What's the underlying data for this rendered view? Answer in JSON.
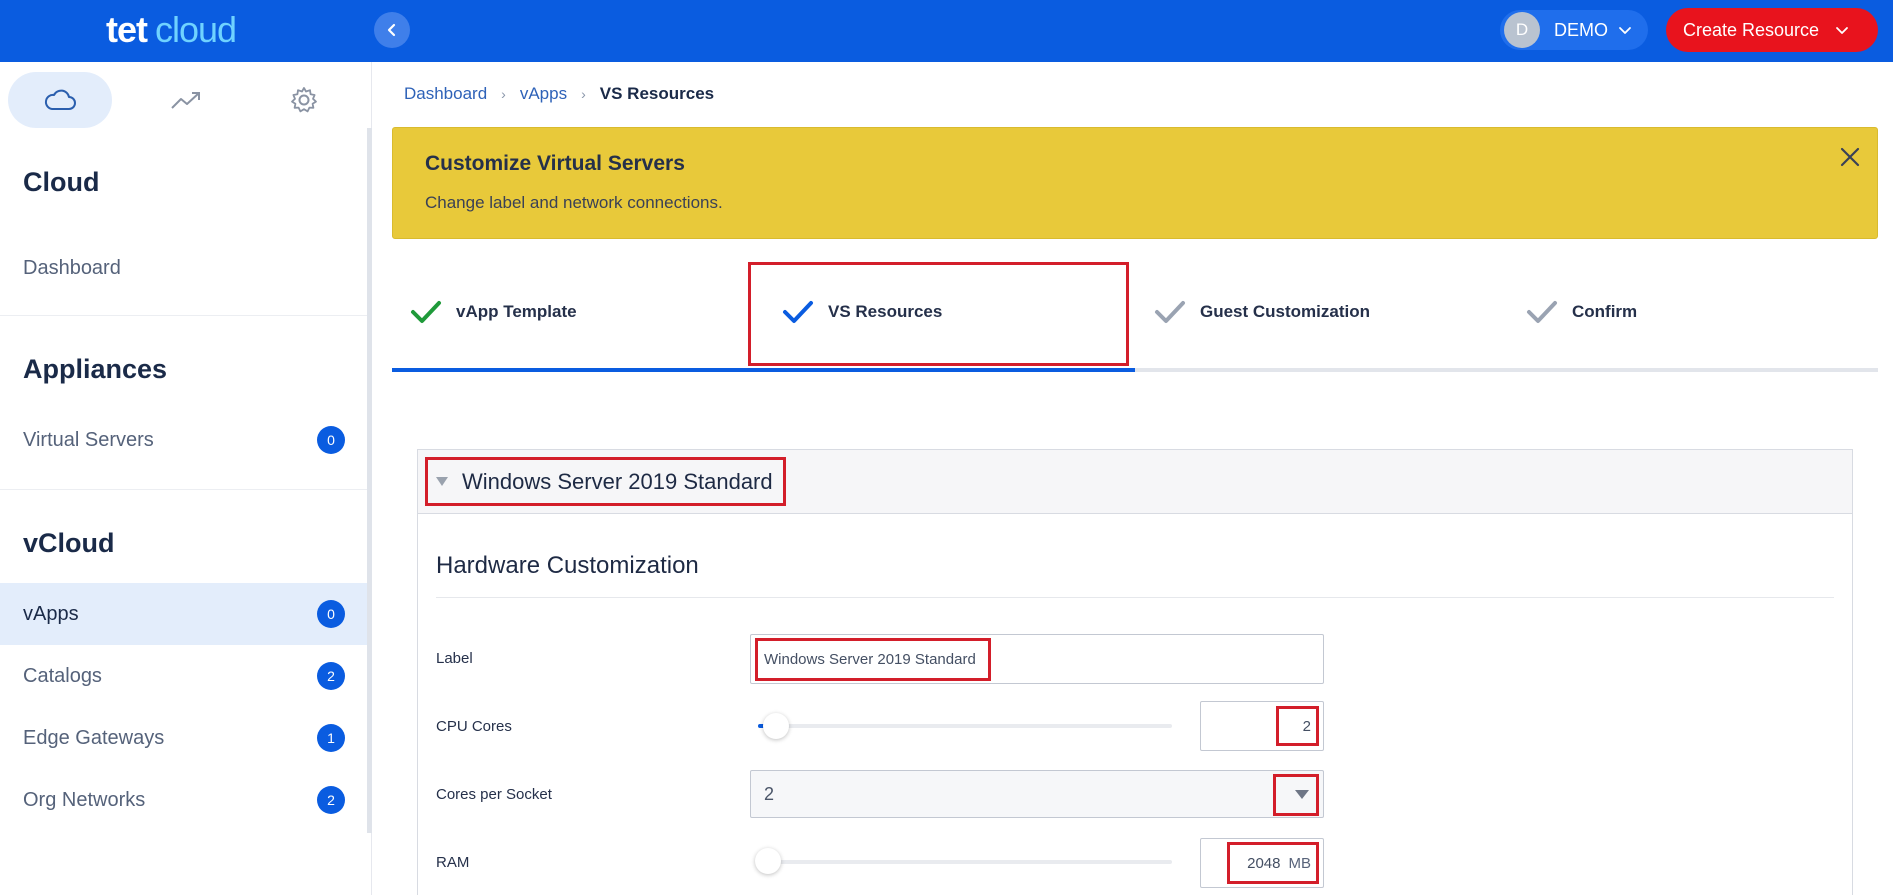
{
  "app": {
    "logo_primary": "tet",
    "logo_secondary": "cloud"
  },
  "header": {
    "user_initial": "D",
    "user_name": "DEMO",
    "create_label": "Create Resource",
    "colors": {
      "bar": "#0a5ce0",
      "create": "#e8131d"
    }
  },
  "sidebar": {
    "tab_icons": [
      "cloud-icon",
      "trend-icon",
      "gear-icon"
    ],
    "sections": [
      {
        "heading": "Cloud",
        "items": [
          {
            "label": "Dashboard"
          }
        ]
      },
      {
        "heading": "Appliances",
        "items": [
          {
            "label": "Virtual Servers",
            "count": "0"
          }
        ]
      },
      {
        "heading": "vCloud",
        "items": [
          {
            "label": "vApps",
            "count": "0",
            "active": true
          },
          {
            "label": "Catalogs",
            "count": "2"
          },
          {
            "label": "Edge Gateways",
            "count": "1"
          },
          {
            "label": "Org Networks",
            "count": "2"
          }
        ]
      }
    ]
  },
  "breadcrumb": {
    "items": [
      "Dashboard",
      "vApps"
    ],
    "current": "VS Resources"
  },
  "banner": {
    "title": "Customize Virtual Servers",
    "text": "Change label and network connections.",
    "color": "#e8c93a"
  },
  "wizard": {
    "steps": [
      {
        "label": "vApp Template",
        "state": "complete"
      },
      {
        "label": "VS Resources",
        "state": "active"
      },
      {
        "label": "Guest Customization",
        "state": "pending"
      },
      {
        "label": "Confirm",
        "state": "pending"
      }
    ],
    "progress_fraction": 0.5
  },
  "panel": {
    "title": "Windows Server 2019 Standard",
    "section_title": "Hardware Customization",
    "fields": {
      "label": {
        "name": "Label",
        "value": "Windows Server 2019 Standard"
      },
      "cpu": {
        "name": "CPU Cores",
        "value": "2",
        "slider_fraction": 0.02
      },
      "cores_per_socket": {
        "name": "Cores per Socket",
        "value": "2"
      },
      "ram": {
        "name": "RAM",
        "value": "2048",
        "unit": "MB",
        "slider_fraction": 0.0
      }
    }
  }
}
